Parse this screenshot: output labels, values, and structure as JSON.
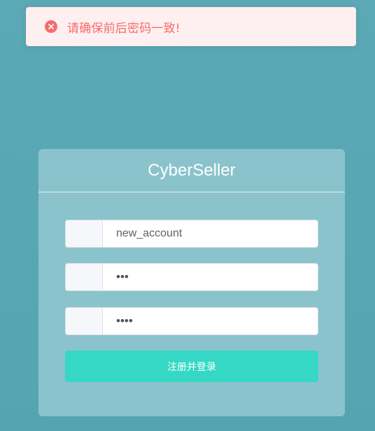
{
  "toast": {
    "message": "请确保前后密码一致!",
    "icon": "close-circle-icon",
    "color": "#f56c6c"
  },
  "card": {
    "title": "CyberSeller",
    "username": {
      "value": "new_account"
    },
    "password": {
      "masked_value": "•••"
    },
    "confirm_password": {
      "masked_value": "••••"
    },
    "submit_label": "注册并登录",
    "accent_color": "#34d8c4"
  }
}
